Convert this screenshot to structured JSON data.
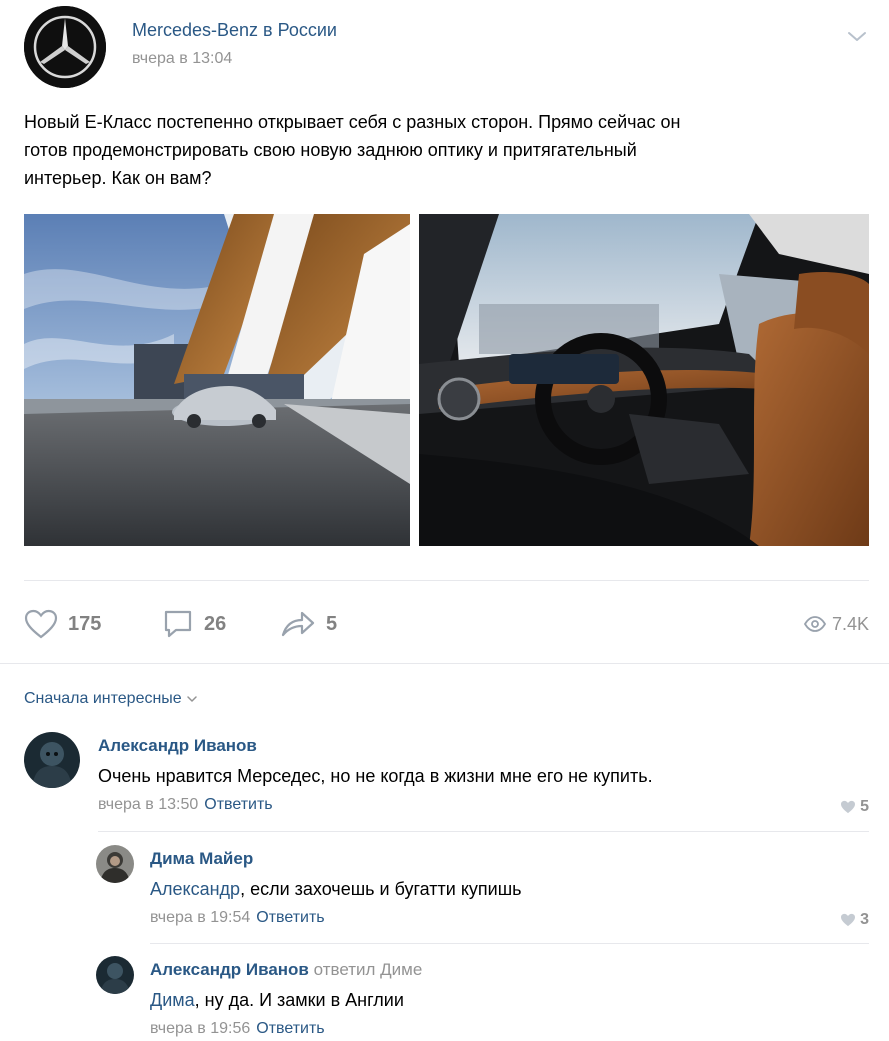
{
  "post": {
    "author": "Mercedes-Benz в России",
    "date": "вчера в 13:04",
    "text_lines": [
      "Новый E-Класс постепенно открывает себя с разных сторон. Прямо сейчас он",
      "готов продемонстрировать свою новую заднюю оптику и притягательный",
      "интерьер. Как он вам?"
    ],
    "photos": [
      "car-exterior-photo",
      "car-interior-photo"
    ]
  },
  "actions": {
    "likes": "175",
    "comments": "26",
    "shares": "5",
    "views": "7.4K"
  },
  "comments_section": {
    "sort_label": "Сначала интересные",
    "items": [
      {
        "author": "Александр Иванов",
        "text": "Очень нравится Мерседес, но не когда в жизни мне его не купить.",
        "date": "вчера в 13:50",
        "reply_label": "Ответить",
        "likes": "5"
      },
      {
        "author": "Дима Майер",
        "mention": "Александр",
        "text": ", если захочешь и бугатти купишь",
        "date": "вчера в 19:54",
        "reply_label": "Ответить",
        "likes": "3"
      },
      {
        "author": "Александр Иванов",
        "reply_to": "ответил Диме",
        "mention": "Дима",
        "text": ", ну да. И замки в Англии",
        "date": "вчера в 19:56",
        "reply_label": "Ответить"
      }
    ]
  },
  "colors": {
    "link": "#2a5885",
    "muted": "#939393",
    "divider": "#e7e8ec",
    "icon": "#99a2ad"
  }
}
